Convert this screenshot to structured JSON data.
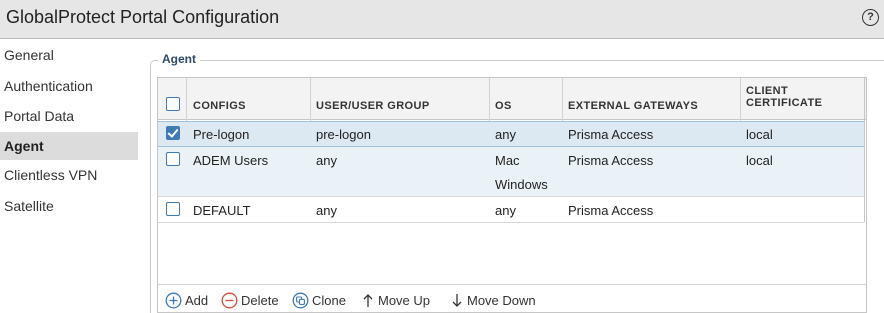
{
  "window": {
    "title": "GlobalProtect Portal Configuration",
    "help_label": "?"
  },
  "sidebar": {
    "items": [
      {
        "label": "General",
        "active": false
      },
      {
        "label": "Authentication",
        "active": false
      },
      {
        "label": "Portal Data Collection",
        "active": false
      },
      {
        "label": "Agent",
        "active": true
      },
      {
        "label": "Clientless VPN",
        "active": false
      },
      {
        "label": "Satellite",
        "active": false
      }
    ]
  },
  "agent": {
    "legend": "Agent",
    "columns": {
      "configs": "CONFIGS",
      "user_group": "USER/USER GROUP",
      "os": "OS",
      "gateways": "EXTERNAL GATEWAYS",
      "cert_line1": "CLIENT",
      "cert_line2": "CERTIFICATE"
    },
    "rows": [
      {
        "checked": true,
        "config": "Pre-logon",
        "user_group": "pre-logon",
        "os": [
          "any"
        ],
        "gateways": "Prisma Access",
        "cert": "local"
      },
      {
        "checked": false,
        "config": "ADEM Users",
        "user_group": "any",
        "os": [
          "Mac",
          "Windows"
        ],
        "gateways": "Prisma Access",
        "cert": "local"
      },
      {
        "checked": false,
        "config": "DEFAULT",
        "user_group": "any",
        "os": [
          "any"
        ],
        "gateways": "Prisma Access",
        "cert": ""
      }
    ],
    "toolbar": {
      "add": "Add",
      "delete": "Delete",
      "clone": "Clone",
      "move_up": "Move Up",
      "move_down": "Move Down"
    }
  },
  "colors": {
    "accent": "#3f7ab3",
    "selected_row": "#dce9f3",
    "header_bg": "#f3f3f3",
    "delete": "#d24b3a"
  }
}
